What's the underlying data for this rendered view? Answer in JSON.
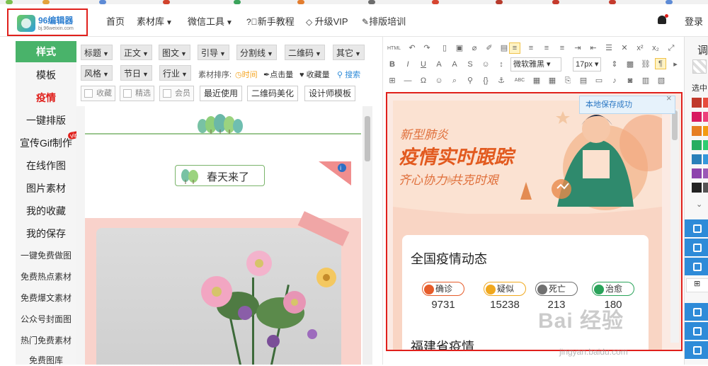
{
  "nav": {
    "logo_title": "96编辑器",
    "logo_url": "bj.96weixin.com",
    "items": [
      {
        "label": "首页",
        "caret": false,
        "icon": ""
      },
      {
        "label": "素材库",
        "caret": true,
        "icon": ""
      },
      {
        "label": "微信工具",
        "caret": true,
        "icon": ""
      },
      {
        "label": "新手教程",
        "caret": false,
        "icon": "question-circle-icon"
      },
      {
        "label": "升级VIP",
        "caret": false,
        "icon": "diamond-icon"
      },
      {
        "label": "排版培训",
        "caret": false,
        "icon": "edit-icon"
      }
    ],
    "login": "登录"
  },
  "sidebar": {
    "items": [
      {
        "label": "样式",
        "state": "active"
      },
      {
        "label": "模板",
        "state": "normal"
      },
      {
        "label": "疫情",
        "state": "red"
      },
      {
        "label": "一键排版",
        "state": "normal"
      },
      {
        "label": "宣传Gif制作",
        "state": "normal",
        "badge": "vip"
      },
      {
        "label": "在线作图",
        "state": "normal"
      },
      {
        "label": "图片素材",
        "state": "normal"
      },
      {
        "label": "我的收藏",
        "state": "normal"
      },
      {
        "label": "我的保存",
        "state": "normal"
      },
      {
        "label": "一键免费做图",
        "state": "small"
      },
      {
        "label": "免费热点素材",
        "state": "small"
      },
      {
        "label": "免费爆文素材",
        "state": "small"
      },
      {
        "label": "公众号封面图",
        "state": "small"
      },
      {
        "label": "热门免费素材",
        "state": "small"
      },
      {
        "label": "免费图库",
        "state": "small"
      }
    ]
  },
  "categories": {
    "row1": [
      "标题",
      "正文",
      "图文",
      "引导",
      "分割线",
      "二维码",
      "其它"
    ],
    "row2": [
      "风格",
      "节日",
      "行业"
    ],
    "sort_label": "素材排序:",
    "sort_options": [
      {
        "label": "时间",
        "icon": "clock-icon",
        "color": "#f5a623"
      },
      {
        "label": "点击量",
        "icon": "pen-icon",
        "color": "#333333"
      },
      {
        "label": "收藏量",
        "icon": "heart-icon",
        "color": "#333333"
      },
      {
        "label": "搜索",
        "icon": "search-icon",
        "color": "#2e8bd8"
      }
    ],
    "checkboxes": [
      "收藏",
      "精选",
      "会员"
    ],
    "buttons": [
      "最近使用",
      "二维码美化",
      "设计师模板"
    ]
  },
  "preview": {
    "spring_label": "春天来了"
  },
  "editor": {
    "font_select": "微软雅黑",
    "size_select": "17px",
    "toast": "本地保存成功",
    "toast_close": "×",
    "poster": {
      "kicker": "新型肺炎",
      "title": "疫情实时跟踪",
      "slogan": "齐心协力 共克时艰",
      "section_national": "全国疫情动态",
      "stats": [
        {
          "label": "确诊",
          "value": "9731",
          "color": "#e65c2a"
        },
        {
          "label": "疑似",
          "value": "15238",
          "color": "#f0a81e"
        },
        {
          "label": "死亡",
          "value": "213",
          "color": "#707070"
        },
        {
          "label": "治愈",
          "value": "180",
          "color": "#2aa35a"
        }
      ],
      "section_province": "福建省疫情"
    }
  },
  "right_panel": {
    "title": "调",
    "label": "选中",
    "colors": [
      "#c0392b",
      "#e74c3c",
      "#d81b60",
      "#ec407a",
      "#e67e22",
      "#f39c12",
      "#27ae60",
      "#2ecc71",
      "#2980b9",
      "#3498db",
      "#8e44ad",
      "#9b59b6",
      "#222222",
      "#555555"
    ]
  },
  "watermark": {
    "main": "Bai 经验",
    "sub": "jingyan.baidu.com"
  },
  "colors": {
    "accent_green": "#49b36a",
    "accent_red": "#e0201c",
    "accent_blue": "#2e8bd8",
    "poster_bg": "#f9d5c4"
  }
}
